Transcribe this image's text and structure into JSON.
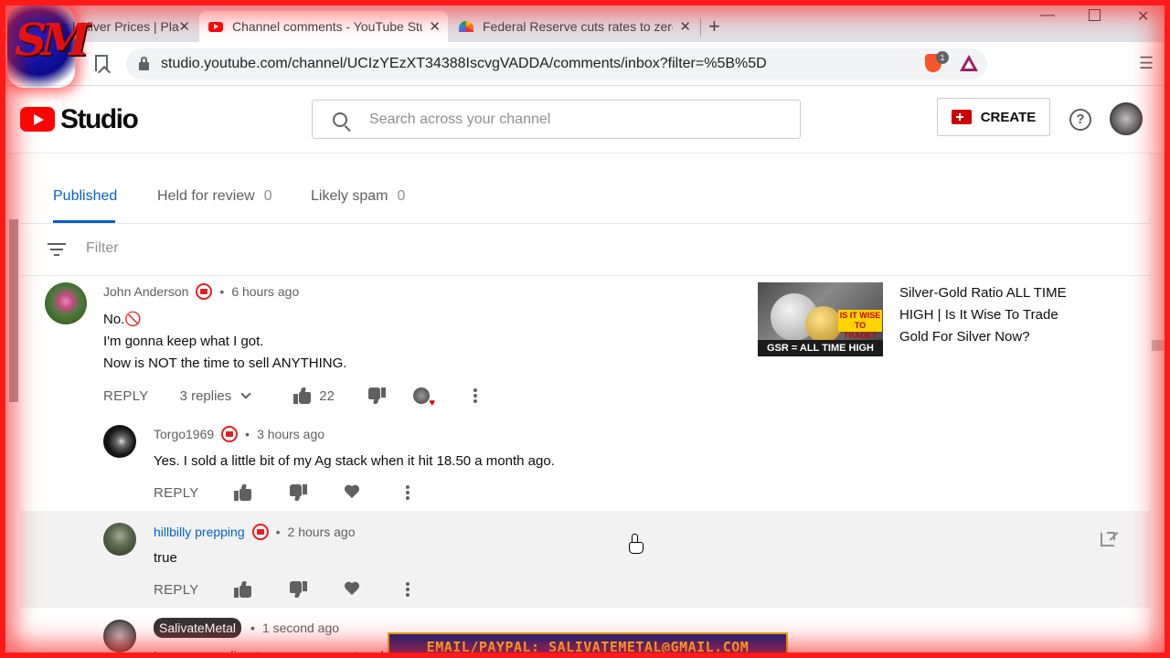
{
  "browser": {
    "tabs": [
      {
        "title": "ices | Silver Prices | Pla"
      },
      {
        "title": "Channel comments - YouTube Stud"
      },
      {
        "title": "Federal Reserve cuts rates to zero"
      }
    ],
    "url": "studio.youtube.com/channel/UCIzYEzXT34388IscvgVADDA/comments/inbox?filter=%5B%5D",
    "brave_badge": "1"
  },
  "header": {
    "brand": "Studio",
    "search_placeholder": "Search across your channel",
    "create_label": "CREATE",
    "help_symbol": "?"
  },
  "overlay": {
    "channel_logo_text": "SM",
    "email_banner": "EMAIL/PAYPAL: SALIVATEMETAL@GMAIL.COM"
  },
  "tabs": [
    {
      "label": "Published",
      "count": ""
    },
    {
      "label": "Held for review",
      "count": "0"
    },
    {
      "label": "Likely spam",
      "count": "0"
    }
  ],
  "filter": {
    "placeholder": "Filter"
  },
  "comments": [
    {
      "author": "John Anderson",
      "time": "6 hours ago",
      "lines": [
        "No.🚫",
        "I'm gonna keep what I got.",
        "Now is NOT the time to sell ANYTHING."
      ],
      "reply_label": "REPLY",
      "replies_label": "3 replies",
      "likes": "22"
    },
    {
      "author": "Torgo1969",
      "time": "3 hours ago",
      "lines": [
        "Yes. I sold a little bit of my Ag stack when it hit 18.50 a month ago."
      ],
      "reply_label": "REPLY"
    },
    {
      "author": "hillbilly prepping",
      "time": "2 hours ago",
      "lines": [
        "true"
      ],
      "reply_label": "REPLY"
    },
    {
      "author": "SalivateMetal",
      "time": "1 second ago",
      "lines": [
        "I am responding to your comment verb"
      ]
    }
  ],
  "video": {
    "title": "Silver-Gold Ratio ALL TIME HIGH | Is It Wise To Trade Gold For Silver Now?",
    "thumb_badge": "IS IT WISE TO TRADE?",
    "thumb_caption": "GSR = ALL TIME HIGH"
  },
  "colors": {
    "accent_blue": "#065fd4",
    "youtube_red": "#ff0000",
    "frame_red": "#ff1a1a"
  }
}
